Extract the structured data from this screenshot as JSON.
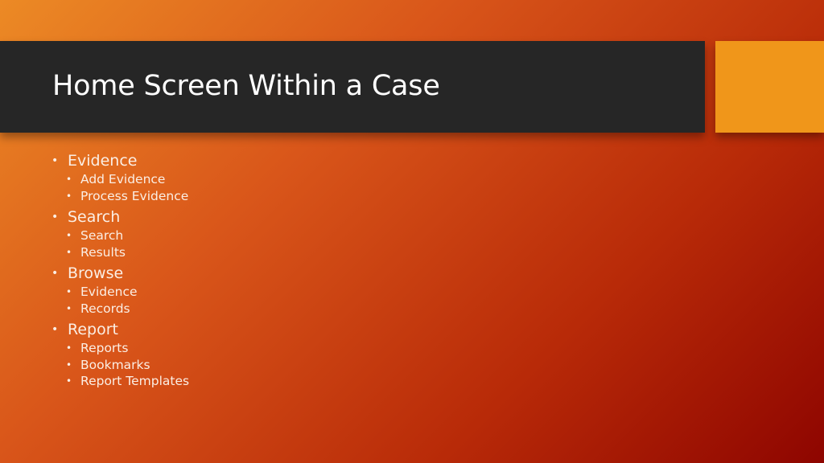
{
  "slide": {
    "title": "Home Screen Within a Case",
    "colors": {
      "title_bar": "#262626",
      "accent_square": "#f0961a",
      "background_start": "#ec8a25",
      "background_end": "#8e0500",
      "text": "#ffffff"
    },
    "bullet_glyph": "•",
    "sections": [
      {
        "label": "Evidence",
        "items": [
          "Add Evidence",
          "Process Evidence"
        ]
      },
      {
        "label": "Search",
        "items": [
          "Search",
          "Results"
        ]
      },
      {
        "label": "Browse",
        "items": [
          "Evidence",
          "Records"
        ]
      },
      {
        "label": "Report",
        "items": [
          "Reports",
          "Bookmarks",
          "Report Templates"
        ]
      }
    ]
  }
}
